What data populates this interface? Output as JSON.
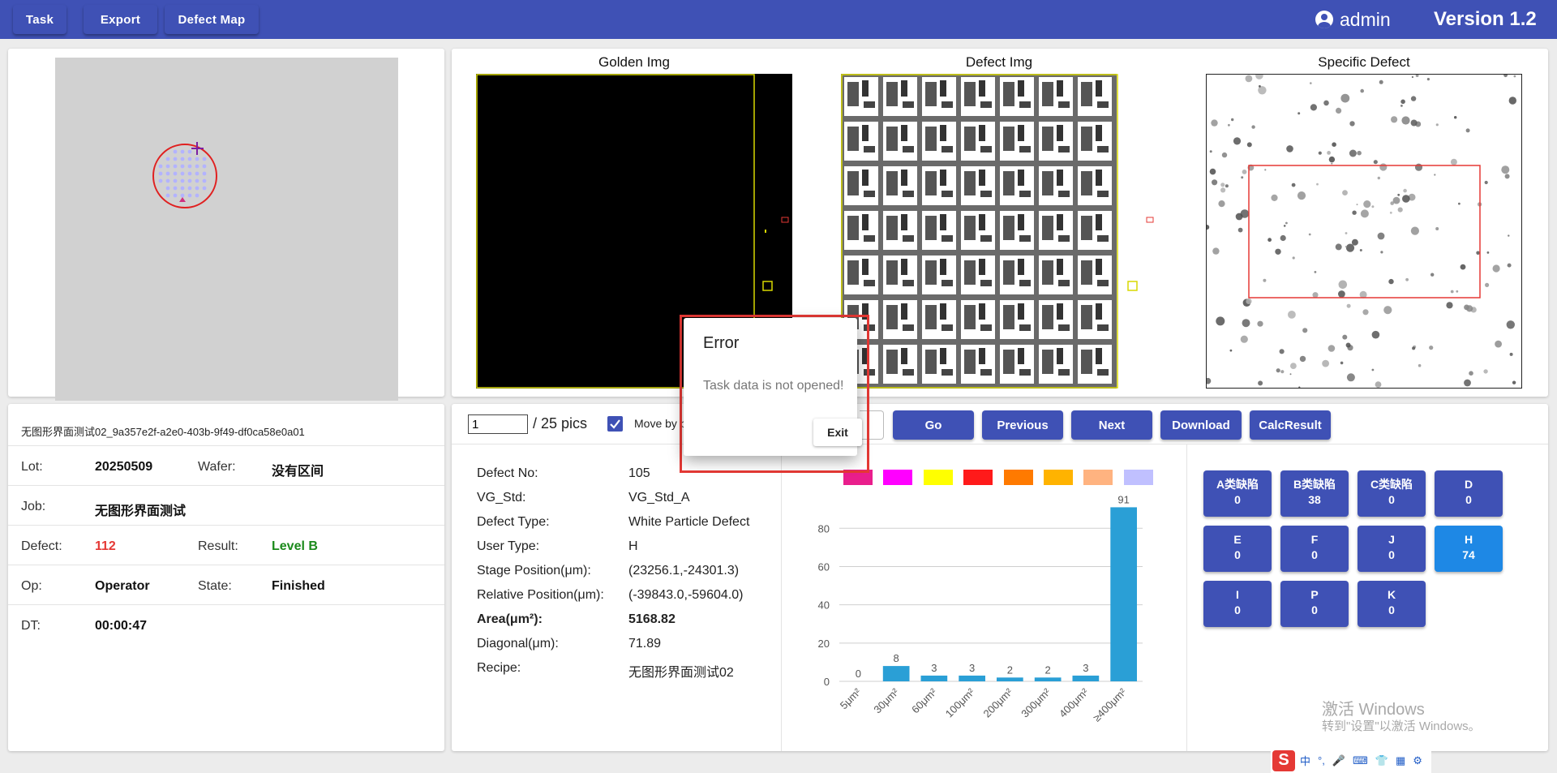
{
  "topbar": {
    "buttons": [
      "Task",
      "Export",
      "Defect Map"
    ],
    "user": "admin",
    "version": "Version 1.2"
  },
  "images": {
    "golden_title": "Golden Img",
    "defect_title": "Defect Img",
    "specific_title": "Specific Defect"
  },
  "info": {
    "task_name": "无图形界面测试02_9a357e2f-a2e0-403b-9f49-df0ca58e0a01",
    "lot_label": "Lot:",
    "lot": "20250509",
    "wafer_label": "Wafer:",
    "wafer": "没有区间",
    "job_label": "Job:",
    "job": "无图形界面测试",
    "defect_label": "Defect:",
    "defect": "112",
    "result_label": "Result:",
    "result": "Level B",
    "op_label": "Op:",
    "op": "Operator",
    "state_label": "State:",
    "state": "Finished",
    "dt_label": "DT:",
    "dt": "00:00:47"
  },
  "controls": {
    "page_value": "1",
    "total": "/ 25 pics",
    "move_checkbox_checked": true,
    "move_label": "Move by p",
    "buttons": [
      "Go",
      "Previous",
      "Next",
      "Download",
      "CalcResult"
    ]
  },
  "details": [
    {
      "label": "Defect No:",
      "value": "105"
    },
    {
      "label": "VG_Std:",
      "value": "VG_Std_A"
    },
    {
      "label": "Defect Type:",
      "value": "White Particle Defect"
    },
    {
      "label": "User Type:",
      "value": "H"
    },
    {
      "label": "Stage Position(μm):",
      "value": "(23256.1,-24301.3)"
    },
    {
      "label": "Relative Position(μm):",
      "value": "(-39843.0,-59604.0)"
    },
    {
      "label": "Area(μm²):",
      "value": "5168.82"
    },
    {
      "label": "Diagonal(μm):",
      "value": "71.89"
    },
    {
      "label": "Recipe:",
      "value": "无图形界面测试02"
    }
  ],
  "legend_colors": [
    "#e91e8c",
    "#ff00ff",
    "#ffff00",
    "#ff1a1a",
    "#ff7a00",
    "#ffb300",
    "#ffb380",
    "#c0c0ff"
  ],
  "chart_data": {
    "type": "bar",
    "categories": [
      "5μm²",
      "30μm²",
      "60μm²",
      "100μm²",
      "200μm²",
      "300μm²",
      "400μm²",
      "≥400μm²"
    ],
    "values": [
      0,
      8,
      3,
      3,
      2,
      2,
      3,
      91
    ],
    "yticks": [
      "0",
      "20",
      "40",
      "60",
      "80"
    ],
    "ylim": [
      0,
      92
    ],
    "bar_color": "#2a9fd6",
    "grid": true
  },
  "classes": [
    {
      "name": "A类缺陷",
      "count": "0"
    },
    {
      "name": "B类缺陷",
      "count": "38"
    },
    {
      "name": "C类缺陷",
      "count": "0"
    },
    {
      "name": "D",
      "count": "0"
    },
    {
      "name": "E",
      "count": "0"
    },
    {
      "name": "F",
      "count": "0"
    },
    {
      "name": "J",
      "count": "0"
    },
    {
      "name": "H",
      "count": "74"
    },
    {
      "name": "I",
      "count": "0"
    },
    {
      "name": "P",
      "count": "0"
    },
    {
      "name": "K",
      "count": "0"
    }
  ],
  "modal": {
    "title": "Error",
    "message": "Task data is not opened!",
    "exit": "Exit"
  },
  "watermark": {
    "line1": "激活 Windows",
    "line2": "转到\"设置\"以激活 Windows。"
  },
  "ime": {
    "logo": "S",
    "items": [
      "中",
      "°,",
      "🎤",
      "⌨",
      "👕",
      "▦",
      "⚙"
    ]
  }
}
